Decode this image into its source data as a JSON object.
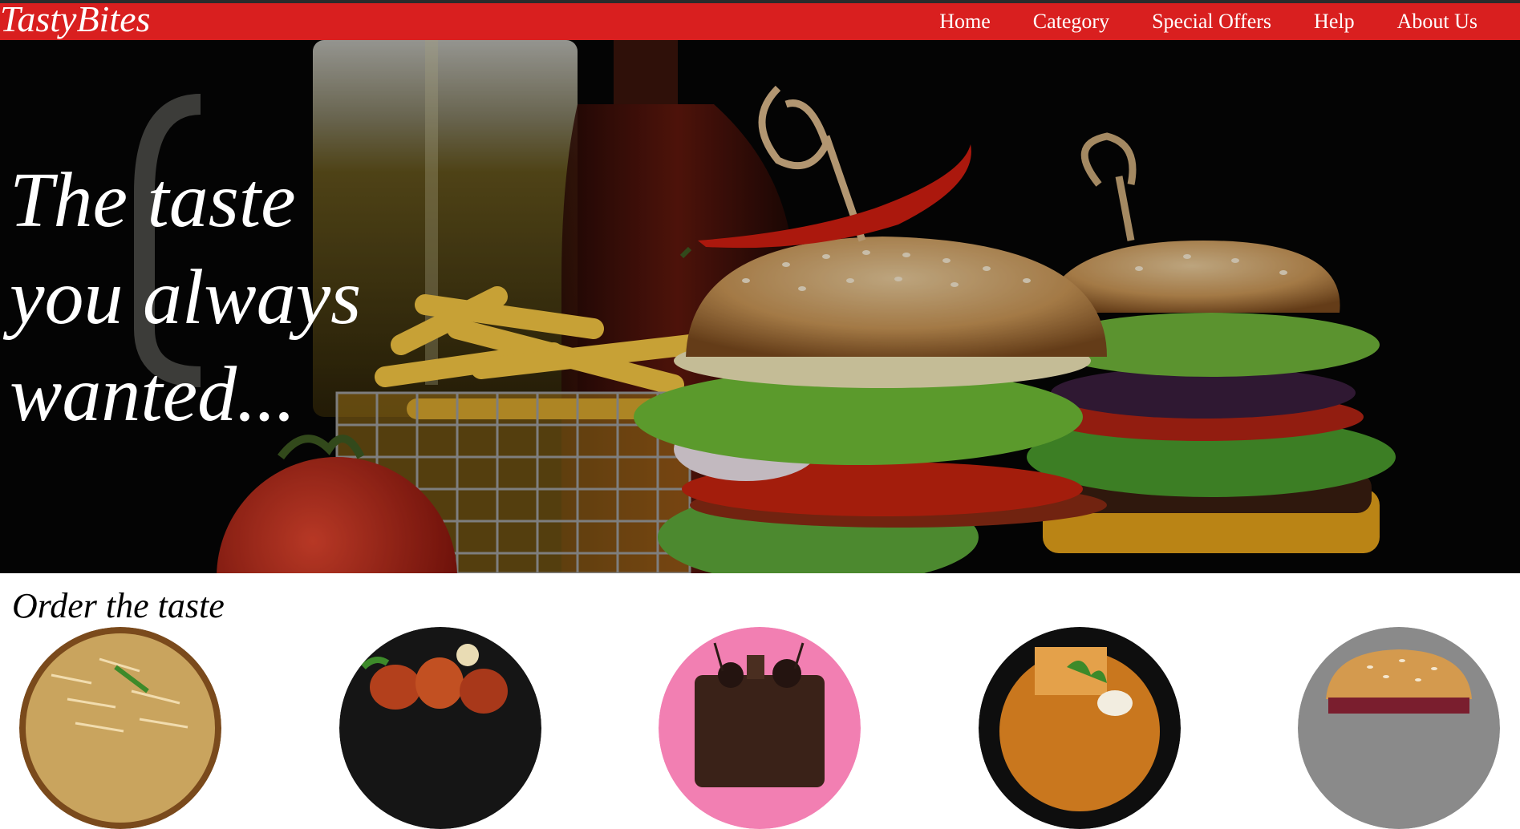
{
  "brand": {
    "name": "TastyBites"
  },
  "nav": {
    "items": [
      "Home",
      "Category",
      "Special Offers",
      "Help",
      "About Us"
    ]
  },
  "hero": {
    "title_lines": [
      "The taste",
      "you always",
      "wanted..."
    ],
    "image": "burger-fries-hero-photo"
  },
  "order_section": {
    "title": "Order the taste",
    "items": [
      "biryani-photo",
      "roast-chicken-photo",
      "chocolate-cake-photo",
      "curry-bowl-photo",
      "burger-photo"
    ]
  },
  "colors": {
    "navbar": "#d91f1f",
    "topline": "#2b2b2b",
    "hero_bg": "#060606",
    "page_bg": "#ffffff"
  }
}
